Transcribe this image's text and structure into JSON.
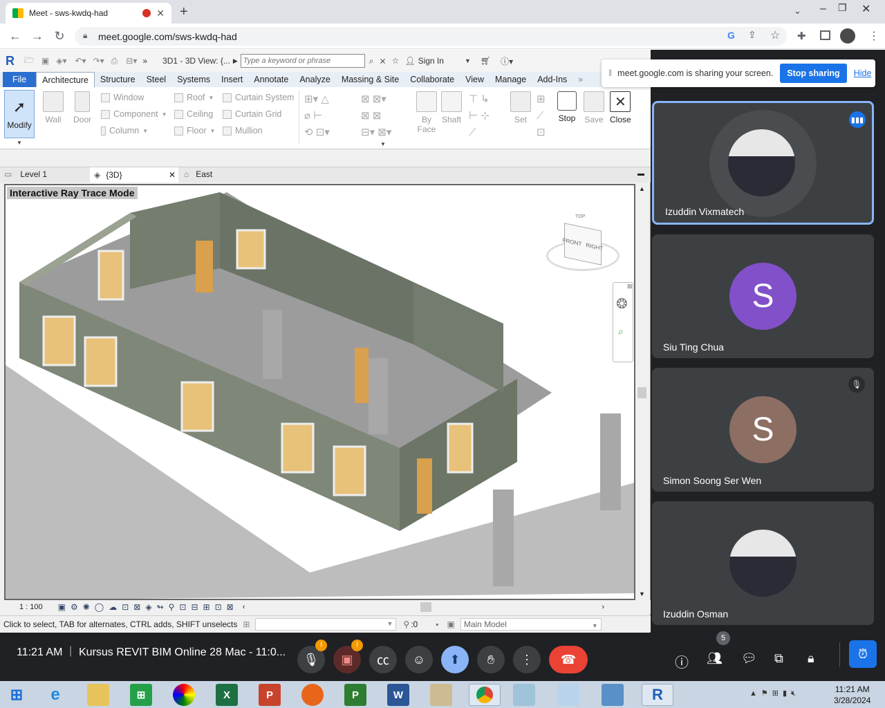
{
  "browser": {
    "tab_title": "Meet - sws-kwdq-had",
    "url": "meet.google.com/sws-kwdq-had"
  },
  "revit": {
    "qat": {
      "view_title": "3D1 - 3D View: {...",
      "search_placeholder": "Type a keyword or phrase",
      "sign_in": "Sign In"
    },
    "tabs": [
      "File",
      "Architecture",
      "Structure",
      "Steel",
      "Systems",
      "Insert",
      "Annotate",
      "Analyze",
      "Massing & Site",
      "Collaborate",
      "View",
      "Manage",
      "Add-Ins"
    ],
    "ribbon": {
      "modify": "Modify",
      "wall": "Wall",
      "door": "Door",
      "window": "Window",
      "component": "Component",
      "column": "Column",
      "roof": "Roof",
      "ceiling": "Ceiling",
      "floor": "Floor",
      "curtain_system": "Curtain System",
      "curtain_grid": "Curtain Grid",
      "mullion": "Mullion",
      "by_face": "By Face",
      "shaft": "Shaft",
      "set": "Set",
      "stop": "Stop",
      "save": "Save",
      "close": "Close"
    },
    "view_tabs": {
      "level1": "Level 1",
      "view3d": "{3D}",
      "east": "East"
    },
    "viewport_label": "Interactive Ray Trace Mode",
    "viewcube": {
      "top": "TOP",
      "front": "FRONT",
      "right": "RIGHT"
    },
    "scale": "1 : 100",
    "status_text": "Click to select, TAB for alternates, CTRL adds, SHIFT unselects",
    "selection_count": ":0",
    "model": "Main Model"
  },
  "meet": {
    "share_message": "meet.google.com is sharing your screen.",
    "stop_sharing": "Stop sharing",
    "hide": "Hide",
    "participants": [
      {
        "name": "Izuddin Vixmatech",
        "initial": "",
        "color": "#5f6368"
      },
      {
        "name": "Siu Ting Chua",
        "initial": "S",
        "color": "#8250c8"
      },
      {
        "name": "Simon Soong Ser Wen",
        "initial": "S",
        "color": "#8d6e63"
      },
      {
        "name": "Izuddin Osman",
        "initial": "",
        "color": "#5f6368"
      }
    ],
    "time": "11:21 AM",
    "meeting_title": "Kursus REVIT BIM Online 28 Mac - 11:0...",
    "people_count": "5"
  },
  "taskbar": {
    "clock_time": "11:21 AM",
    "clock_date": "3/28/2024"
  }
}
